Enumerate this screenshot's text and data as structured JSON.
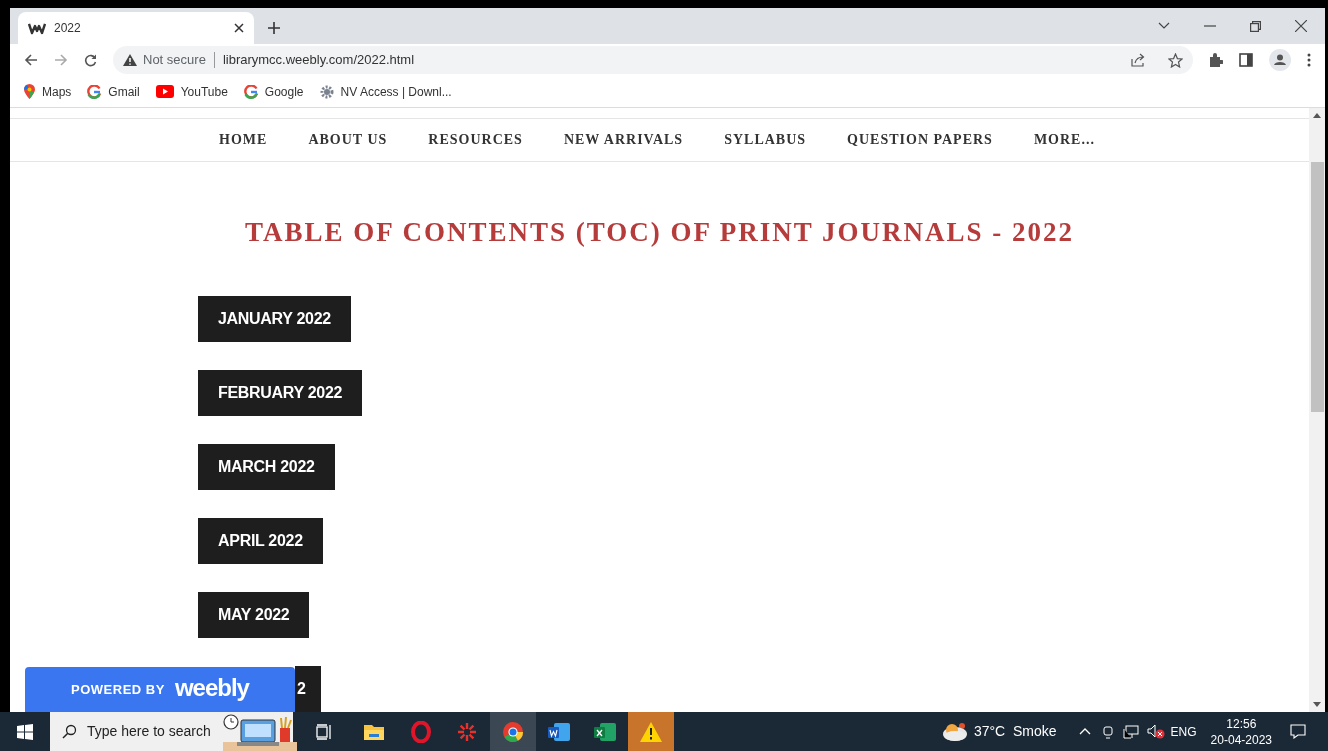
{
  "browser": {
    "tab": {
      "title": "2022"
    },
    "address": {
      "security": "Not secure",
      "url": "librarymcc.weebly.com/2022.html"
    },
    "bookmarks": [
      {
        "kind": "maps",
        "label": "Maps"
      },
      {
        "kind": "google",
        "label": "Gmail"
      },
      {
        "kind": "youtube",
        "label": "YouTube"
      },
      {
        "kind": "google",
        "label": "Google"
      },
      {
        "kind": "gear",
        "label": "NV Access | Downl..."
      }
    ]
  },
  "nav": {
    "items": [
      "HOME",
      "ABOUT US",
      "RESOURCES",
      "NEW ARRIVALS",
      "SYLLABUS",
      "QUESTION PAPERS",
      "MORE..."
    ]
  },
  "page": {
    "heading": "TABLE OF CONTENTS (TOC) OF PRINT JOURNALS - 2022",
    "months": [
      "JANUARY 2022",
      "FEBRUARY 2022",
      "MARCH 2022",
      "APRIL 2022",
      "MAY 2022",
      "2"
    ]
  },
  "badge": {
    "powered_by": "POWERED BY",
    "brand": "weebly"
  },
  "taskbar": {
    "search_placeholder": "Type here to search",
    "weather": "37°C  Smoke",
    "language": "ENG",
    "time": "12:56",
    "date": "20-04-2023"
  }
}
